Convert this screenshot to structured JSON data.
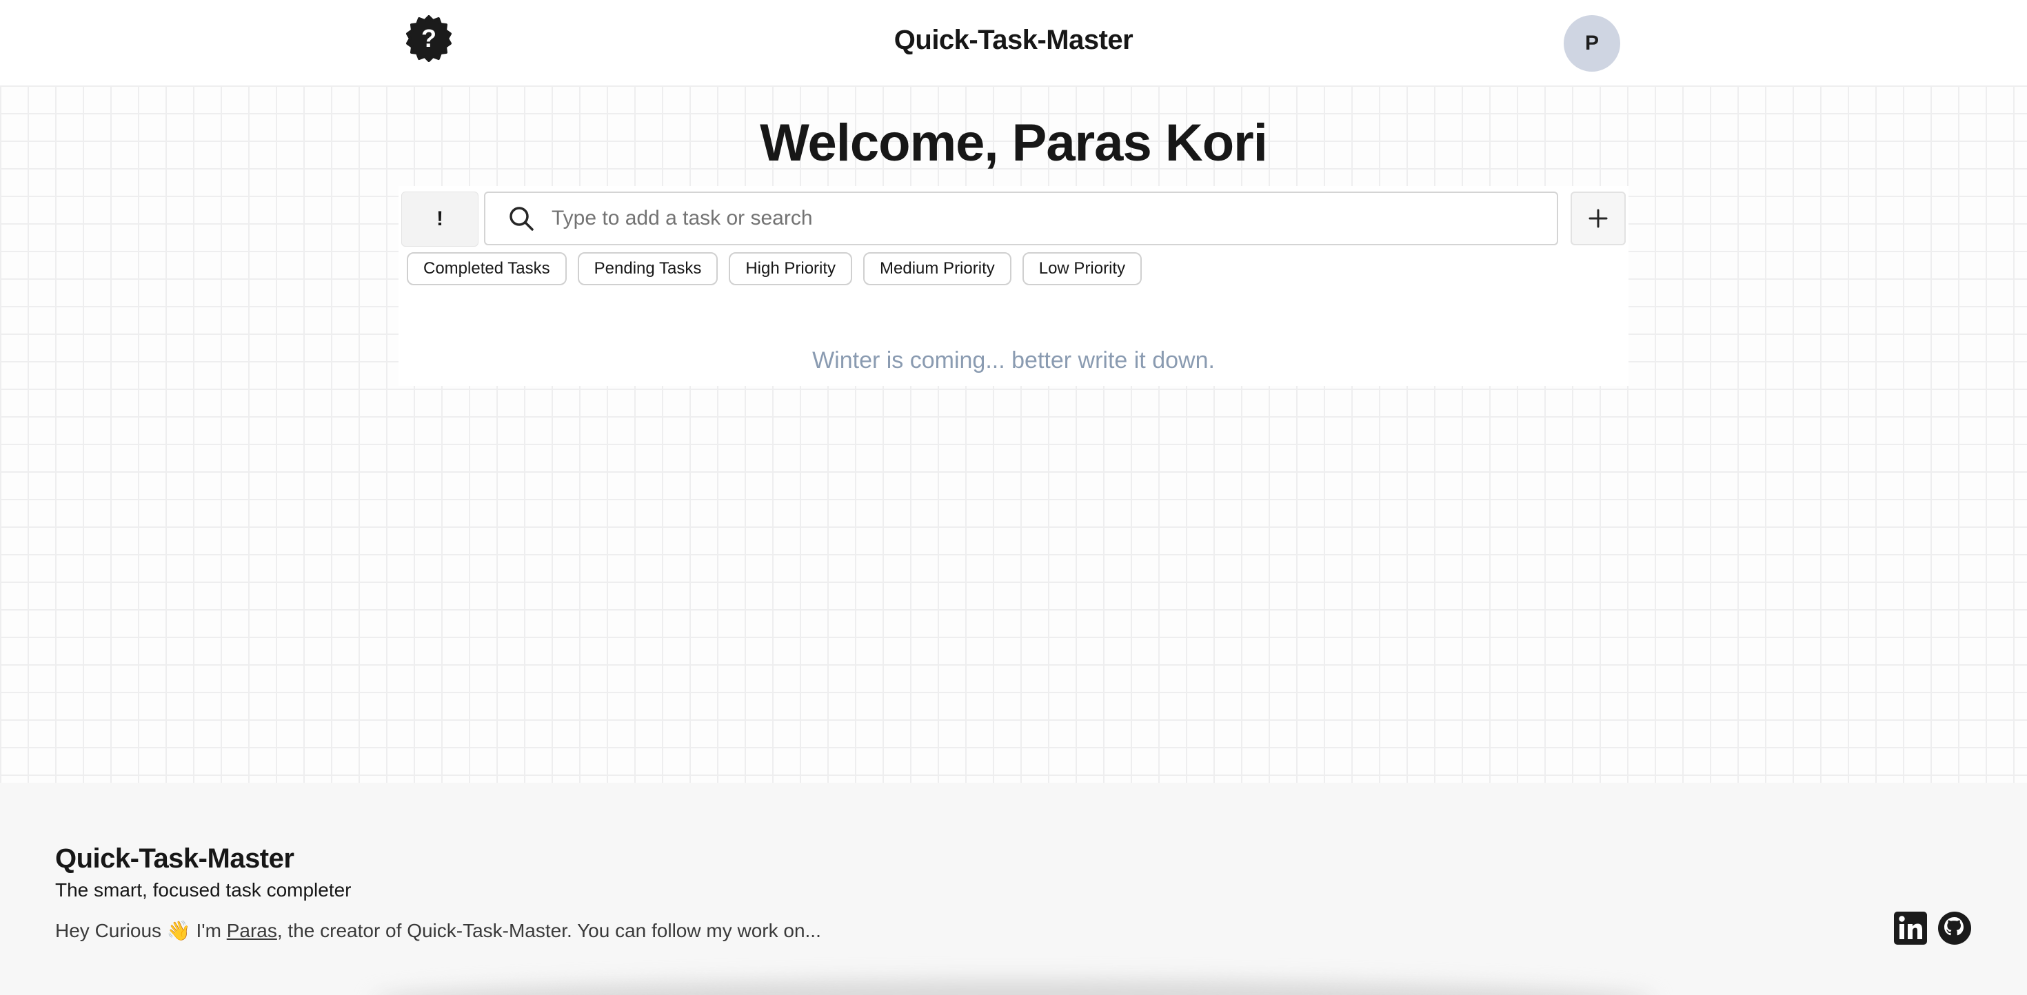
{
  "header": {
    "help_icon": "help-badge-icon",
    "title": "Quick-Task-Master",
    "avatar_initial": "P"
  },
  "main": {
    "welcome": "Welcome, Paras Kori",
    "priority_button_label": "!",
    "search": {
      "icon": "search-icon",
      "placeholder": "Type to add a task or search",
      "value": ""
    },
    "add_button_icon": "plus-icon",
    "filters": [
      "Completed Tasks",
      "Pending Tasks",
      "High Priority",
      "Medium Priority",
      "Low Priority"
    ],
    "empty_message": "Winter is coming... better write it down."
  },
  "footer": {
    "title": "Quick-Task-Master",
    "tagline": "The smart, focused task completer",
    "intro_prefix": "Hey Curious 👋 I'm ",
    "creator_name": "Paras",
    "intro_suffix": ", the creator of Quick-Task-Master. You can follow my work on...",
    "social": [
      "linkedin-icon",
      "github-icon"
    ]
  },
  "colors": {
    "avatar_bg": "#cfd5e2",
    "empty_message": "#8a9bb1",
    "footer_bg": "#f7f7f7",
    "grid_line": "#eeeeef"
  }
}
